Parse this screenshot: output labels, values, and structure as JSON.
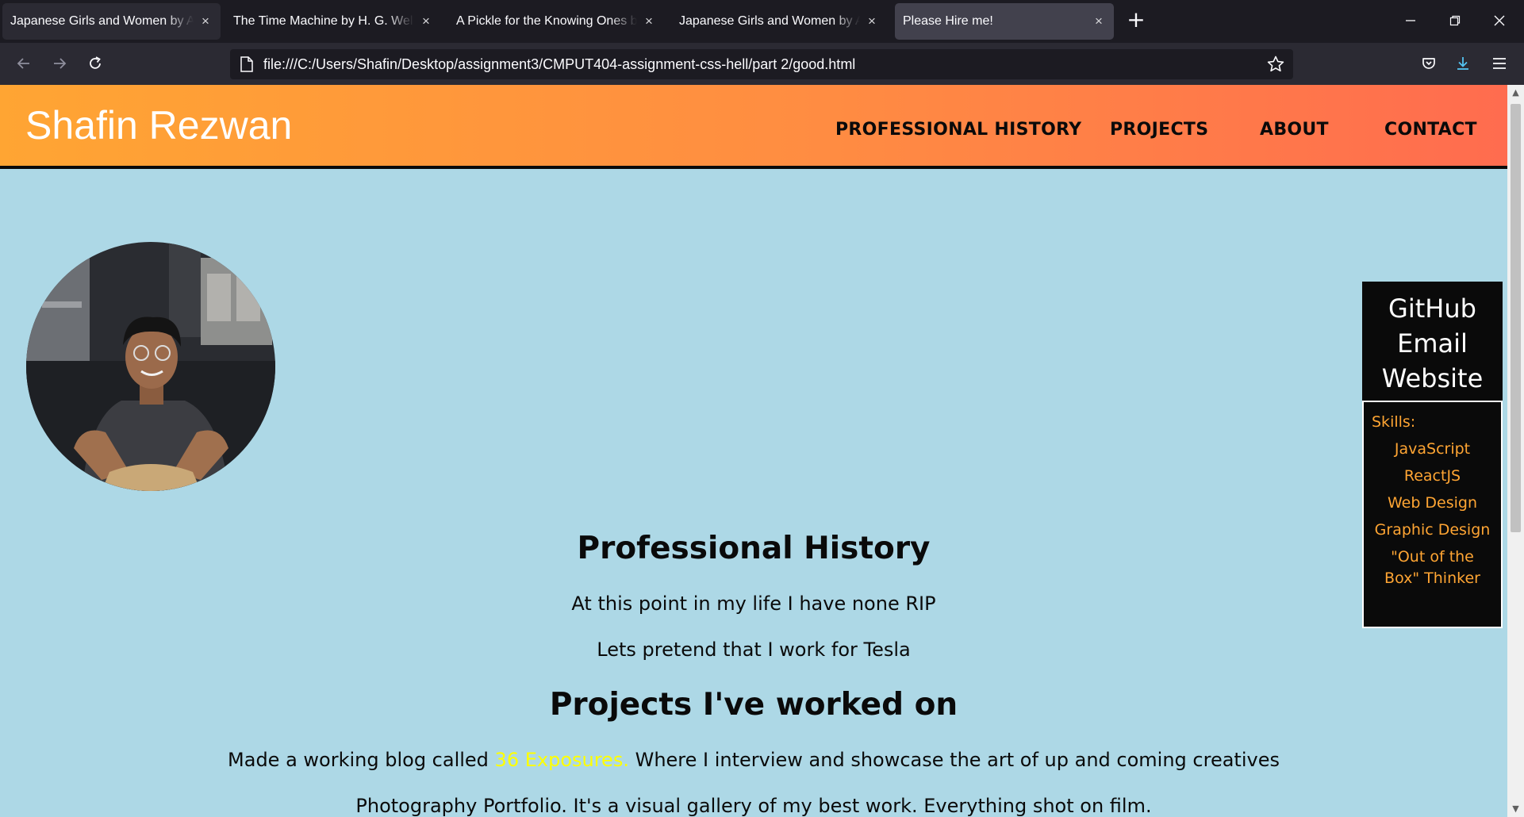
{
  "browser": {
    "tabs": [
      {
        "label": "Japanese Girls and Women by Alice"
      },
      {
        "label": "The Time Machine by H. G. Wells - F"
      },
      {
        "label": "A Pickle for the Knowing Ones by Ti"
      },
      {
        "label": "Japanese Girls and Women by Alice"
      },
      {
        "label": "Please Hire me!",
        "active": true
      }
    ],
    "url": "file:///C:/Users/Shafin/Desktop/assignment3/CMPUT404-assignment-css-hell/part 2/good.html",
    "icons": [
      "back-arrow-icon",
      "forward-arrow-icon",
      "reload-icon",
      "page-icon",
      "bookmark-star-icon",
      "pocket-icon",
      "download-icon",
      "hamburger-menu-icon",
      "new-tab-icon",
      "minimize-icon",
      "restore-icon",
      "close-icon"
    ]
  },
  "site": {
    "title": "Shafin Rezwan",
    "nav": [
      "PROFESSIONAL HISTORY",
      "PROJECTS",
      "ABOUT",
      "CONTACT"
    ],
    "links": [
      "GitHub",
      "Email",
      "Website"
    ],
    "skills_title": "Skills:",
    "skills": [
      "JavaScript",
      "ReactJS",
      "Web Design",
      "Graphic Design",
      "\"Out of the Box\" Thinker"
    ],
    "history_heading": "Professional History",
    "history_lines": [
      "At this point in my life I have none RIP",
      "Lets pretend that I work for Tesla"
    ],
    "projects_heading": "Projects I've worked on",
    "project_1_prefix": "Made a working blog called ",
    "project_1_link": "36 Exposures.",
    "project_1_suffix": " Where I interview and showcase the art of up and coming creatives",
    "project_2": "Photography Portfolio. It's a visual gallery of my best work. Everything shot on film."
  },
  "colors": {
    "header_gradient_start": "#ffa533",
    "header_gradient_end": "#ff6c4f",
    "page_background": "#add8e6",
    "skills_text": "#ffa533",
    "link_yellow": "#ffff00"
  }
}
